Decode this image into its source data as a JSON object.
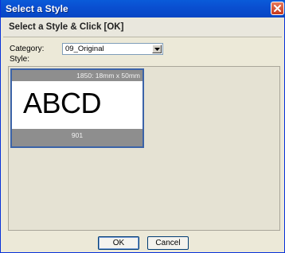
{
  "window": {
    "title": "Select a Style"
  },
  "heading": "Select a Style & Click [OK]",
  "category": {
    "label": "Category:",
    "value": "09_Original"
  },
  "style": {
    "label": "Style:",
    "items": [
      {
        "size": "1850: 18mm x 50mm",
        "sample": "ABCD",
        "number": "901",
        "selected": true
      }
    ]
  },
  "buttons": {
    "ok": "OK",
    "cancel": "Cancel"
  },
  "icons": {
    "close": "close-icon",
    "dropdown": "chevron-down-icon"
  }
}
